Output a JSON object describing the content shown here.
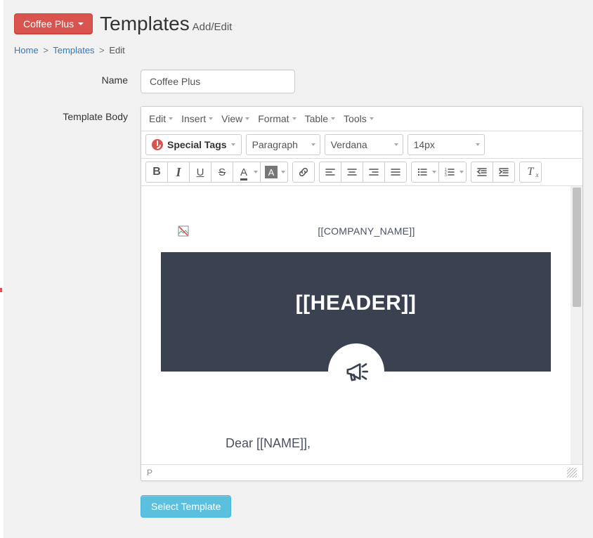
{
  "header": {
    "site_button_label": "Coffee Plus",
    "title": "Templates",
    "subtitle": "Add/Edit"
  },
  "breadcrumb": {
    "home": "Home",
    "templates": "Templates",
    "current": "Edit"
  },
  "form": {
    "name_label": "Name",
    "name_value": "Coffee Plus",
    "body_label": "Template Body"
  },
  "editor": {
    "menus": {
      "edit": "Edit",
      "insert": "Insert",
      "view": "View",
      "format": "Format",
      "table": "Table",
      "tools": "Tools"
    },
    "toolbar": {
      "special_tags": "Special Tags",
      "block_format": "Paragraph",
      "font_family": "Verdana",
      "font_size": "14px"
    },
    "status_path": "P"
  },
  "email_preview": {
    "company_placeholder": "[[COMPANY_NAME]]",
    "header_placeholder": "[[HEADER]]",
    "greeting": "Dear [[NAME]],"
  },
  "actions": {
    "select_template": "Select Template"
  }
}
